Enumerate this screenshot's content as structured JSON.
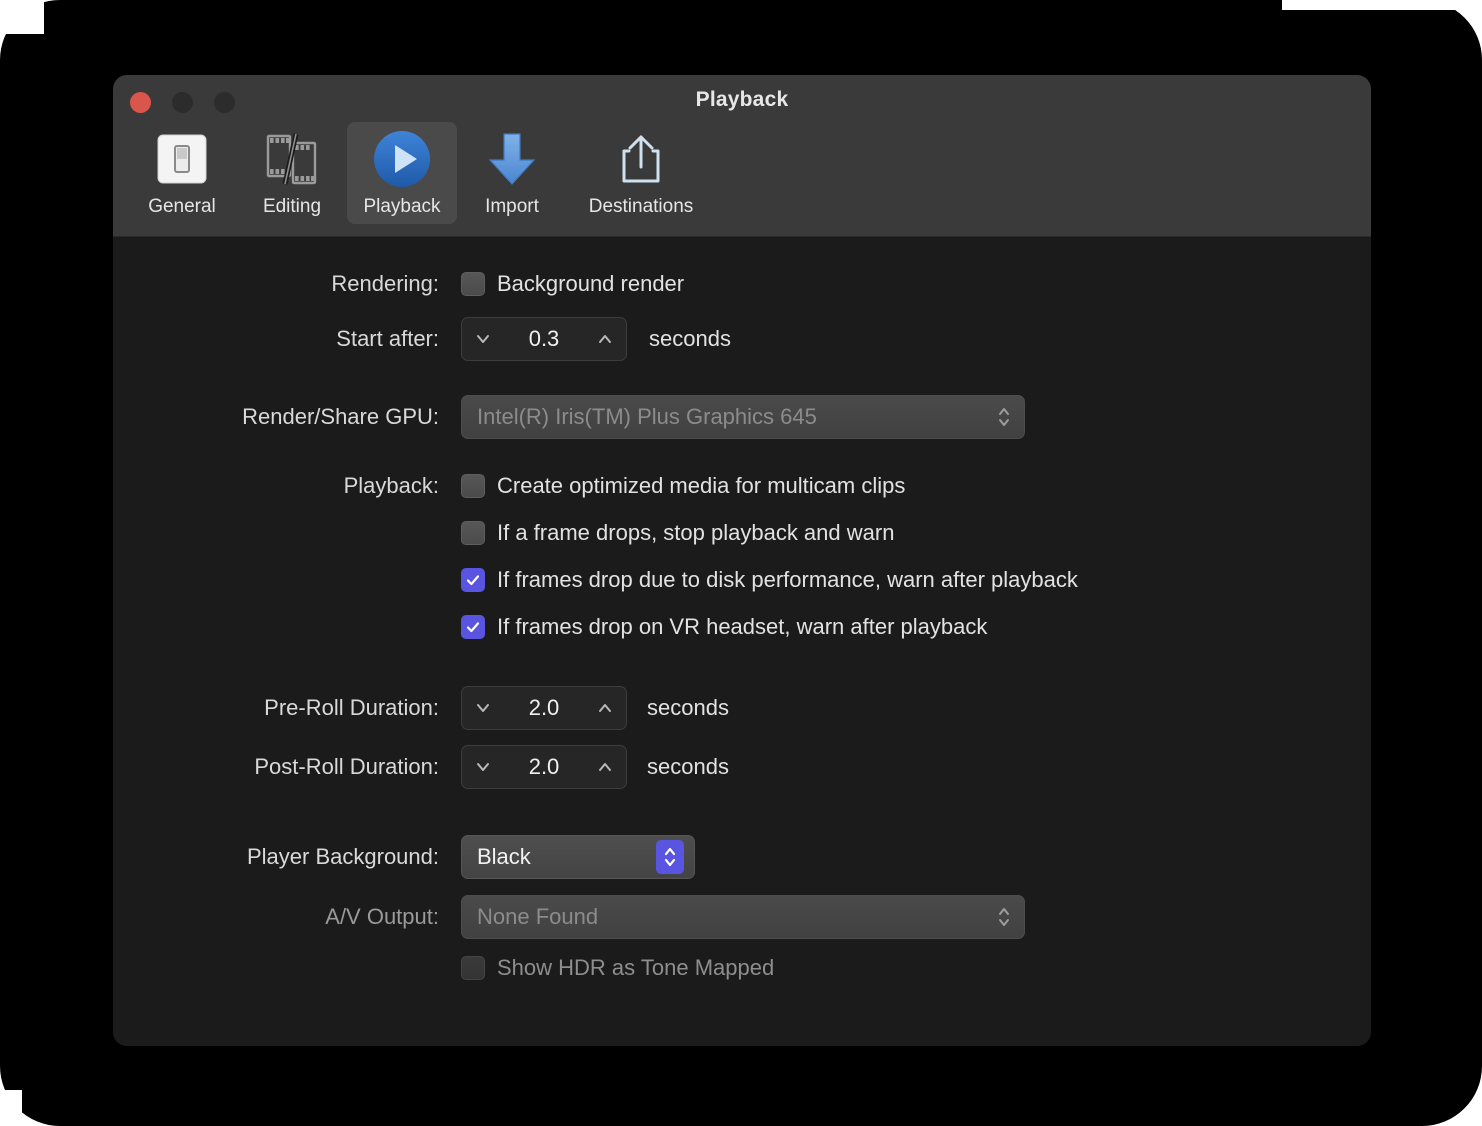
{
  "window": {
    "title": "Playback",
    "traffic_lights": [
      "close",
      "minimize",
      "zoom"
    ]
  },
  "toolbar": {
    "items": [
      {
        "label": "General",
        "icon": "switch-icon",
        "selected": false
      },
      {
        "label": "Editing",
        "icon": "filmstrip-icon",
        "selected": false
      },
      {
        "label": "Playback",
        "icon": "play-circle-icon",
        "selected": true
      },
      {
        "label": "Import",
        "icon": "down-arrow-icon",
        "selected": false
      },
      {
        "label": "Destinations",
        "icon": "share-icon",
        "selected": false
      }
    ]
  },
  "settings": {
    "rendering": {
      "label": "Rendering:",
      "background_render": {
        "label": "Background render",
        "checked": false
      },
      "start_after": {
        "label": "Start after:",
        "value": "0.3",
        "unit": "seconds"
      }
    },
    "gpu": {
      "label": "Render/Share GPU:",
      "value": "Intel(R) Iris(TM) Plus Graphics 645",
      "enabled": false
    },
    "playback": {
      "label": "Playback:",
      "options": [
        {
          "label": "Create optimized media for multicam clips",
          "checked": false
        },
        {
          "label": "If a frame drops, stop playback and warn",
          "checked": false
        },
        {
          "label": "If frames drop due to disk performance, warn after playback",
          "checked": true
        },
        {
          "label": "If frames drop on VR headset, warn after playback",
          "checked": true
        }
      ]
    },
    "pre_roll": {
      "label": "Pre-Roll Duration:",
      "value": "2.0",
      "unit": "seconds"
    },
    "post_roll": {
      "label": "Post-Roll Duration:",
      "value": "2.0",
      "unit": "seconds"
    },
    "player_background": {
      "label": "Player Background:",
      "value": "Black",
      "enabled": true
    },
    "av_output": {
      "label": "A/V Output:",
      "value": "None Found",
      "enabled": false
    },
    "hdr": {
      "label": "Show HDR as Tone Mapped",
      "checked": false,
      "enabled": false
    }
  },
  "colors": {
    "accent_checkbox": "#5a55e0",
    "window_bg": "#1b1b1b",
    "chrome_bg": "#3a3a3a",
    "close_button": "#d8564c",
    "play_icon_blue": "#2a6fc4",
    "import_arrow_blue": "#5f9ae0"
  }
}
